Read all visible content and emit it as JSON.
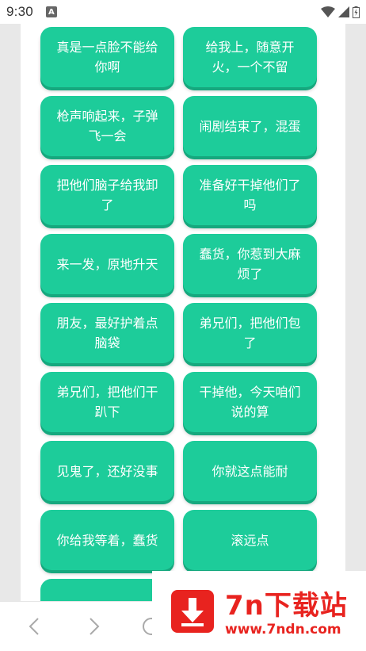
{
  "status_bar": {
    "time": "9:30",
    "notification_icon": "A"
  },
  "phrases": [
    "真是一点脸不能给你啊",
    "给我上，随意开火，一个不留",
    "枪声响起来，子弹飞一会",
    "闹剧结束了，混蛋",
    "把他们脑子给我卸了",
    "准备好干掉他们了吗",
    "来一发，原地升天",
    "蠢货，你惹到大麻烦了",
    "朋友，最好护着点脑袋",
    "弟兄们，把他们包了",
    "弟兄们，把他们干趴下",
    "干掉他，今天咱们说的算",
    "见鬼了，还好没事",
    "你就这点能耐",
    "你给我等着，蠢货",
    "滚远点"
  ],
  "navigation": {
    "back_icon": "chevron-left-icon",
    "forward_icon": "chevron-right-icon"
  },
  "watermark": {
    "title": "7n下载站",
    "url": "www.7ndn.com"
  },
  "colors": {
    "button": "#1dcc9a",
    "button_shadow": "#16a87e",
    "watermark": "#e8231f"
  }
}
